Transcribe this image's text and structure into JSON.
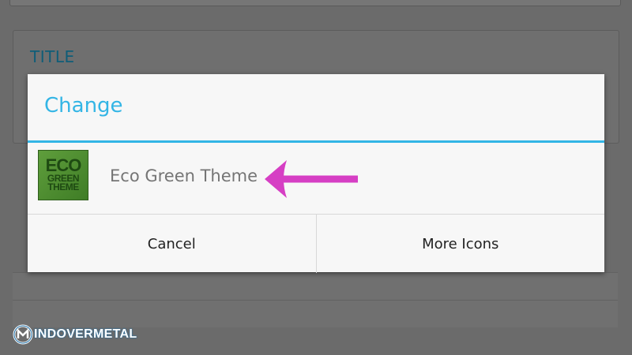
{
  "background": {
    "card_title": "TITLE"
  },
  "dialog": {
    "title": "Change",
    "option": {
      "label": "Eco Green Theme",
      "icon": {
        "line1": "ECO",
        "line2": "GREEN",
        "line3": "THEME"
      }
    },
    "buttons": {
      "cancel": "Cancel",
      "more_icons": "More Icons"
    }
  },
  "watermark": {
    "text": "INDOVERMETAL"
  },
  "colors": {
    "accent": "#33b5e5",
    "arrow": "#d63fc4",
    "dim_background": "#6b6b6b"
  }
}
